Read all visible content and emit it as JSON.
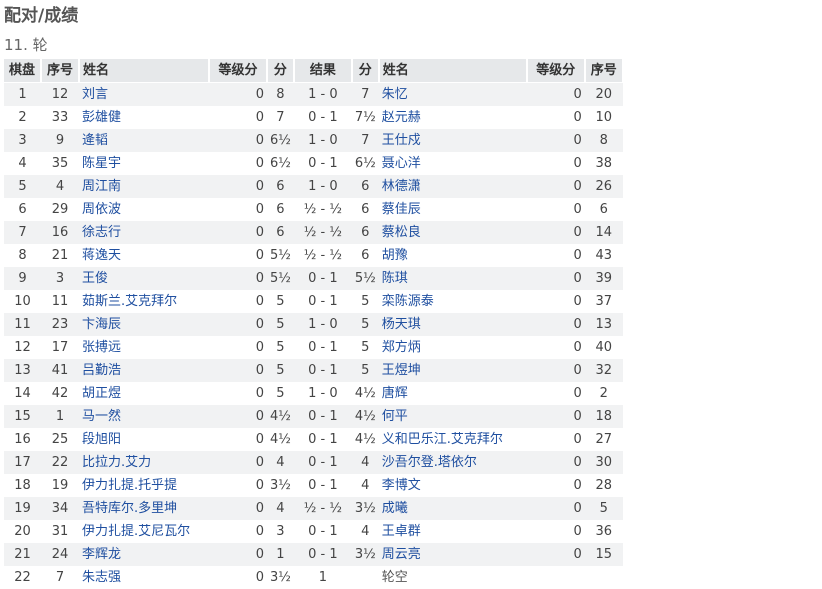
{
  "page": {
    "title": "配对/成绩",
    "round": "11. 轮"
  },
  "table": {
    "headers": {
      "board": "棋盘",
      "seq": "序号",
      "name": "姓名",
      "rating": "等级分",
      "points": "分",
      "result": "结果",
      "points2": "分",
      "name2": "姓名",
      "rating2": "等级分",
      "seq2": "序号"
    },
    "rows": [
      {
        "board": "1",
        "seq": "12",
        "name": "刘言",
        "rating": "0",
        "pts": "8",
        "result": "1 - 0",
        "pts2": "7",
        "name2": "朱忆",
        "rating2": "0",
        "seq2": "20"
      },
      {
        "board": "2",
        "seq": "33",
        "name": "彭雄健",
        "rating": "0",
        "pts": "7",
        "result": "0 - 1",
        "pts2": "7½",
        "name2": "赵元赫",
        "rating2": "0",
        "seq2": "10"
      },
      {
        "board": "3",
        "seq": "9",
        "name": "逄韬",
        "rating": "0",
        "pts": "6½",
        "result": "1 - 0",
        "pts2": "7",
        "name2": "王仕戍",
        "rating2": "0",
        "seq2": "8"
      },
      {
        "board": "4",
        "seq": "35",
        "name": "陈星宇",
        "rating": "0",
        "pts": "6½",
        "result": "0 - 1",
        "pts2": "6½",
        "name2": "聂心洋",
        "rating2": "0",
        "seq2": "38"
      },
      {
        "board": "5",
        "seq": "4",
        "name": "周江南",
        "rating": "0",
        "pts": "6",
        "result": "1 - 0",
        "pts2": "6",
        "name2": "林德潇",
        "rating2": "0",
        "seq2": "26"
      },
      {
        "board": "6",
        "seq": "29",
        "name": "周依波",
        "rating": "0",
        "pts": "6",
        "result": "½ - ½",
        "pts2": "6",
        "name2": "蔡佳辰",
        "rating2": "0",
        "seq2": "6"
      },
      {
        "board": "7",
        "seq": "16",
        "name": "徐志行",
        "rating": "0",
        "pts": "6",
        "result": "½ - ½",
        "pts2": "6",
        "name2": "蔡松良",
        "rating2": "0",
        "seq2": "14"
      },
      {
        "board": "8",
        "seq": "21",
        "name": "蒋逸天",
        "rating": "0",
        "pts": "5½",
        "result": "½ - ½",
        "pts2": "6",
        "name2": "胡豫",
        "rating2": "0",
        "seq2": "43"
      },
      {
        "board": "9",
        "seq": "3",
        "name": "王俊",
        "rating": "0",
        "pts": "5½",
        "result": "0 - 1",
        "pts2": "5½",
        "name2": "陈琪",
        "rating2": "0",
        "seq2": "39"
      },
      {
        "board": "10",
        "seq": "11",
        "name": "茹斯兰.艾克拜尔",
        "rating": "0",
        "pts": "5",
        "result": "0 - 1",
        "pts2": "5",
        "name2": "栾陈源泰",
        "rating2": "0",
        "seq2": "37"
      },
      {
        "board": "11",
        "seq": "23",
        "name": "卞海辰",
        "rating": "0",
        "pts": "5",
        "result": "1 - 0",
        "pts2": "5",
        "name2": "杨天琪",
        "rating2": "0",
        "seq2": "13"
      },
      {
        "board": "12",
        "seq": "17",
        "name": "张搏远",
        "rating": "0",
        "pts": "5",
        "result": "0 - 1",
        "pts2": "5",
        "name2": "郑方炳",
        "rating2": "0",
        "seq2": "40"
      },
      {
        "board": "13",
        "seq": "41",
        "name": "吕勤浩",
        "rating": "0",
        "pts": "5",
        "result": "0 - 1",
        "pts2": "5",
        "name2": "王煜坤",
        "rating2": "0",
        "seq2": "32"
      },
      {
        "board": "14",
        "seq": "42",
        "name": "胡正煜",
        "rating": "0",
        "pts": "5",
        "result": "1 - 0",
        "pts2": "4½",
        "name2": "唐辉",
        "rating2": "0",
        "seq2": "2"
      },
      {
        "board": "15",
        "seq": "1",
        "name": "马一然",
        "rating": "0",
        "pts": "4½",
        "result": "0 - 1",
        "pts2": "4½",
        "name2": "何平",
        "rating2": "0",
        "seq2": "18"
      },
      {
        "board": "16",
        "seq": "25",
        "name": "段旭阳",
        "rating": "0",
        "pts": "4½",
        "result": "0 - 1",
        "pts2": "4½",
        "name2": "义和巴乐江.艾克拜尔",
        "rating2": "0",
        "seq2": "27"
      },
      {
        "board": "17",
        "seq": "22",
        "name": "比拉力.艾力",
        "rating": "0",
        "pts": "4",
        "result": "0 - 1",
        "pts2": "4",
        "name2": "沙吾尔登.塔依尔",
        "rating2": "0",
        "seq2": "30"
      },
      {
        "board": "18",
        "seq": "19",
        "name": "伊力扎提.托乎提",
        "rating": "0",
        "pts": "3½",
        "result": "0 - 1",
        "pts2": "4",
        "name2": "李博文",
        "rating2": "0",
        "seq2": "28"
      },
      {
        "board": "19",
        "seq": "34",
        "name": "吾特库尔.多里坤",
        "rating": "0",
        "pts": "4",
        "result": "½ - ½",
        "pts2": "3½",
        "name2": "成曦",
        "rating2": "0",
        "seq2": "5"
      },
      {
        "board": "20",
        "seq": "31",
        "name": "伊力扎提.艾尼瓦尔",
        "rating": "0",
        "pts": "3",
        "result": "0 - 1",
        "pts2": "4",
        "name2": "王卓群",
        "rating2": "0",
        "seq2": "36"
      },
      {
        "board": "21",
        "seq": "24",
        "name": "李辉龙",
        "rating": "0",
        "pts": "1",
        "result": "0 - 1",
        "pts2": "3½",
        "name2": "周云亮",
        "rating2": "0",
        "seq2": "15"
      },
      {
        "board": "22",
        "seq": "7",
        "name": "朱志强",
        "rating": "0",
        "pts": "3½",
        "result": "1",
        "pts2": "",
        "name2": "轮空",
        "rating2": "",
        "seq2": "",
        "bye": true
      }
    ]
  }
}
